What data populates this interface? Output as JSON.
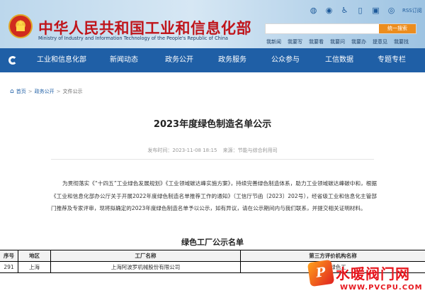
{
  "header": {
    "title_cn": "中华人民共和国工业和信息化部",
    "title_en": "Ministry of Industry and Information Technology of the People's Republic of China",
    "icons": [
      "wechat-icon",
      "weibo-icon",
      "accessibility-icon",
      "mobile-icon",
      "app-icon",
      "sound-icon"
    ],
    "rss_label": "RSS订阅",
    "search_placeholder": "",
    "search_button": "统一搜索",
    "quick_links": [
      "我新闻",
      "我要写",
      "我要看",
      "我要问",
      "我要办",
      "提意见",
      "我要找"
    ]
  },
  "nav": {
    "items": [
      "工业和信息化部",
      "新闻动态",
      "政务公开",
      "政务服务",
      "公众参与",
      "工信数据",
      "专题专栏"
    ]
  },
  "breadcrumb": {
    "items": [
      "首页",
      "政务公开",
      "文件公示"
    ]
  },
  "article": {
    "title": "2023年度绿色制造名单公示",
    "publish_time": "发布时间：2023-11-08 18:15",
    "source": "来源：节能与综合利用司",
    "body": "为贯彻落实《“十四五”工业绿色发展规划》《工业领域碳达峰实施方案》，持续完善绿色制造体系，助力工业领域碳达峰碳中和，根据《工业和信息化部办公厅关于开展2022年度绿色制造名单推荐工作的通知》（工信厅节函〔2023〕202号），经省级工业和信息化主管部门推荐及专家评审，现将拟确定的2023年度绿色制造名单予以公示，如有异议，请在公示期间内与我们联系，并提交相关证明材料。",
    "table_title": "绿色工厂公示名单"
  },
  "table": {
    "headers": [
      "序号",
      "地区",
      "工厂名称",
      "第三方评价机构名称"
    ],
    "rows": [
      [
        "291",
        "上海",
        "上海阿波罗机械股份有限公司",
        "上海绿色工"
      ]
    ]
  },
  "watermark": {
    "cn": "水暖阀门网",
    "en": "WWW.PVCPU.COM"
  },
  "colors": {
    "nav_bg": "#1f5fa6",
    "title_red": "#c0151b",
    "search_button": "#ec8d1e",
    "watermark_red": "#e6161d"
  }
}
